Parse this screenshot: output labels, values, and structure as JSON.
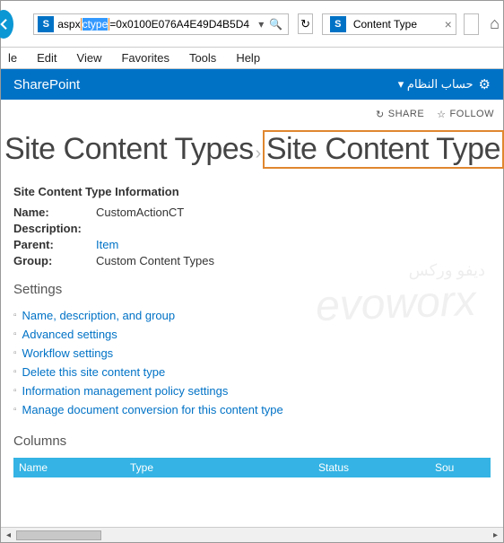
{
  "browser": {
    "url_pre": "aspx",
    "url_hl_sel": "ctype",
    "url_post": "=0x0100E076A4E49D4B5D4",
    "tab": "Content Type"
  },
  "menu": [
    "le",
    "Edit",
    "View",
    "Favorites",
    "Tools",
    "Help"
  ],
  "brand": "SharePoint",
  "account": "حساب النظام",
  "actions": {
    "share": "SHARE",
    "follow": "FOLLOW"
  },
  "crumb": {
    "parent": "Site Content Types",
    "current": "Site Content Type"
  },
  "info_header": "Site Content Type Information",
  "info": {
    "name_lbl": "Name:",
    "name": "CustomActionCT",
    "desc_lbl": "Description:",
    "parent_lbl": "Parent:",
    "parent": "Item",
    "group_lbl": "Group:",
    "group": "Custom Content Types"
  },
  "settings_h": "Settings",
  "settings": [
    "Name, description, and group",
    "Advanced settings",
    "Workflow settings",
    "Delete this site content type",
    "Information management policy settings",
    "Manage document conversion for this content type"
  ],
  "columns_h": "Columns",
  "cols": [
    "Name",
    "Type",
    "Status",
    "Sou"
  ],
  "watermark": "evoworx",
  "watermark_ar": "ديفو وركس"
}
